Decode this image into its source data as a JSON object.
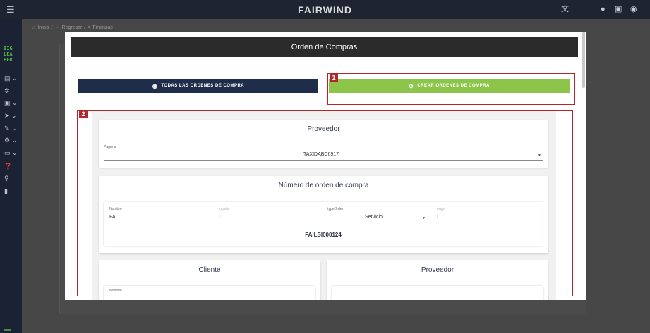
{
  "app": {
    "brand": "FAIRWIND",
    "logo_lines": [
      "BIG",
      "LEA",
      "PER"
    ]
  },
  "topbar_icons": [
    "menu-icon",
    "translate-icon",
    "bell-icon",
    "chat-icon",
    "account-icon"
  ],
  "breadcrumb": {
    "home_label": "Inicio",
    "separator": "/",
    "back_label": "Regresar",
    "section_label": "Finanzas"
  },
  "modal": {
    "title": "Orden de Compras"
  },
  "buttons": {
    "todas_label": "TODAS LAS ORDENES DE COMPRA",
    "crear_label": "CREAR ORDENES DE COMPRA"
  },
  "annotations": [
    "1",
    "2"
  ],
  "proveedor_section": {
    "title": "Proveedor",
    "field_label": "Pagar a",
    "field_value": "TAXIDABC6917"
  },
  "orden_section": {
    "title": "Número de orden de compra",
    "fields": {
      "nombre": {
        "label": "Nombre",
        "value": "FAI"
      },
      "logistic": {
        "label": "logistic",
        "value": "L"
      },
      "type_order": {
        "label": "typeOrder",
        "value": "Servicio"
      },
      "origin": {
        "label": "origin",
        "value": "I"
      }
    },
    "code": "FAILSI000124"
  },
  "cliente_section": {
    "title": "Cliente",
    "field_label": "Nombre"
  },
  "proveedor2_section": {
    "title": "Proveedor"
  }
}
